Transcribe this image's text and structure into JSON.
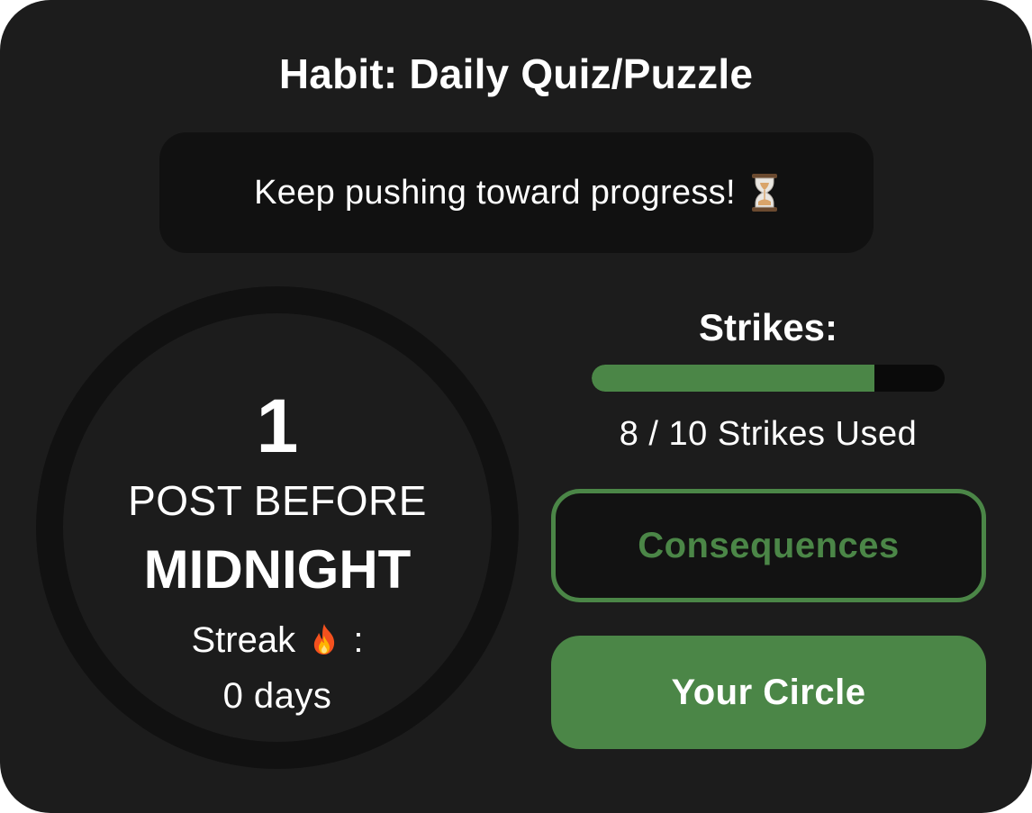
{
  "habit": {
    "title": "Habit: Daily Quiz/Puzzle"
  },
  "banner": {
    "message": "Keep pushing toward progress!",
    "icon": "hourglass-icon"
  },
  "countdown": {
    "number": "1",
    "line1": "POST BEFORE",
    "line2": "MIDNIGHT",
    "streak_label": "Streak",
    "streak_icon": "fire-icon",
    "streak_colon": ":",
    "streak_value": "0 days"
  },
  "strikes": {
    "label": "Strikes:",
    "used": 8,
    "total": 10,
    "used_text": "8 / 10 Strikes Used",
    "fill_color": "#4b8647",
    "track_color": "#0a0a0a"
  },
  "buttons": {
    "consequences_label": "Consequences",
    "circle_label": "Your Circle",
    "accent_color": "#4b8647"
  }
}
